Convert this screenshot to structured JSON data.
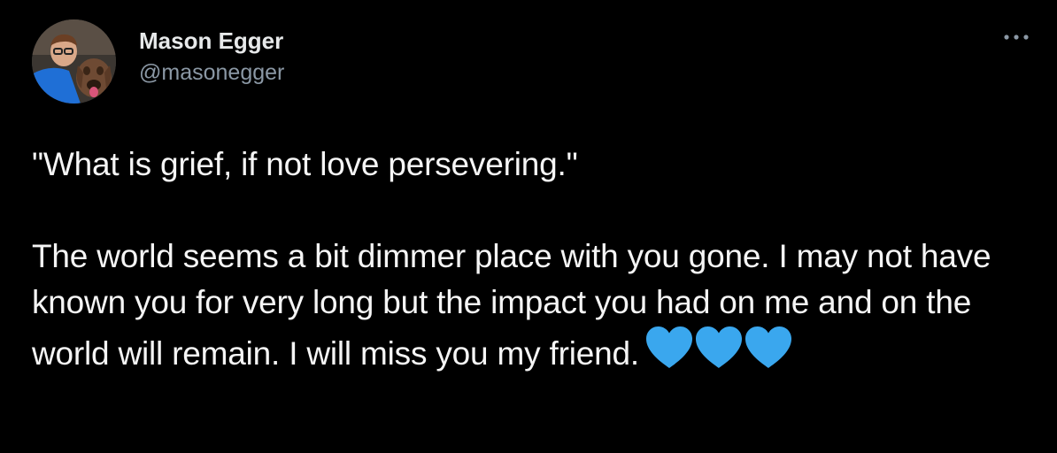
{
  "author": {
    "display_name": "Mason Egger",
    "handle": "@masonegger"
  },
  "more_button": {
    "icon": "more-horizontal-icon"
  },
  "tweet": {
    "paragraph_1": "\"What is grief, if not love persevering.\"",
    "paragraph_2": "The world seems a bit dimmer place with you gone. I may not have known you for very long but the impact you had on me and on the world will remain. I will miss you my friend.",
    "emoji": [
      "blue-heart-icon",
      "blue-heart-icon",
      "blue-heart-icon"
    ]
  },
  "colors": {
    "background": "#000000",
    "text": "#e7e9ea",
    "secondary_text": "#8b98a5",
    "heart": "#3aa7ee"
  }
}
